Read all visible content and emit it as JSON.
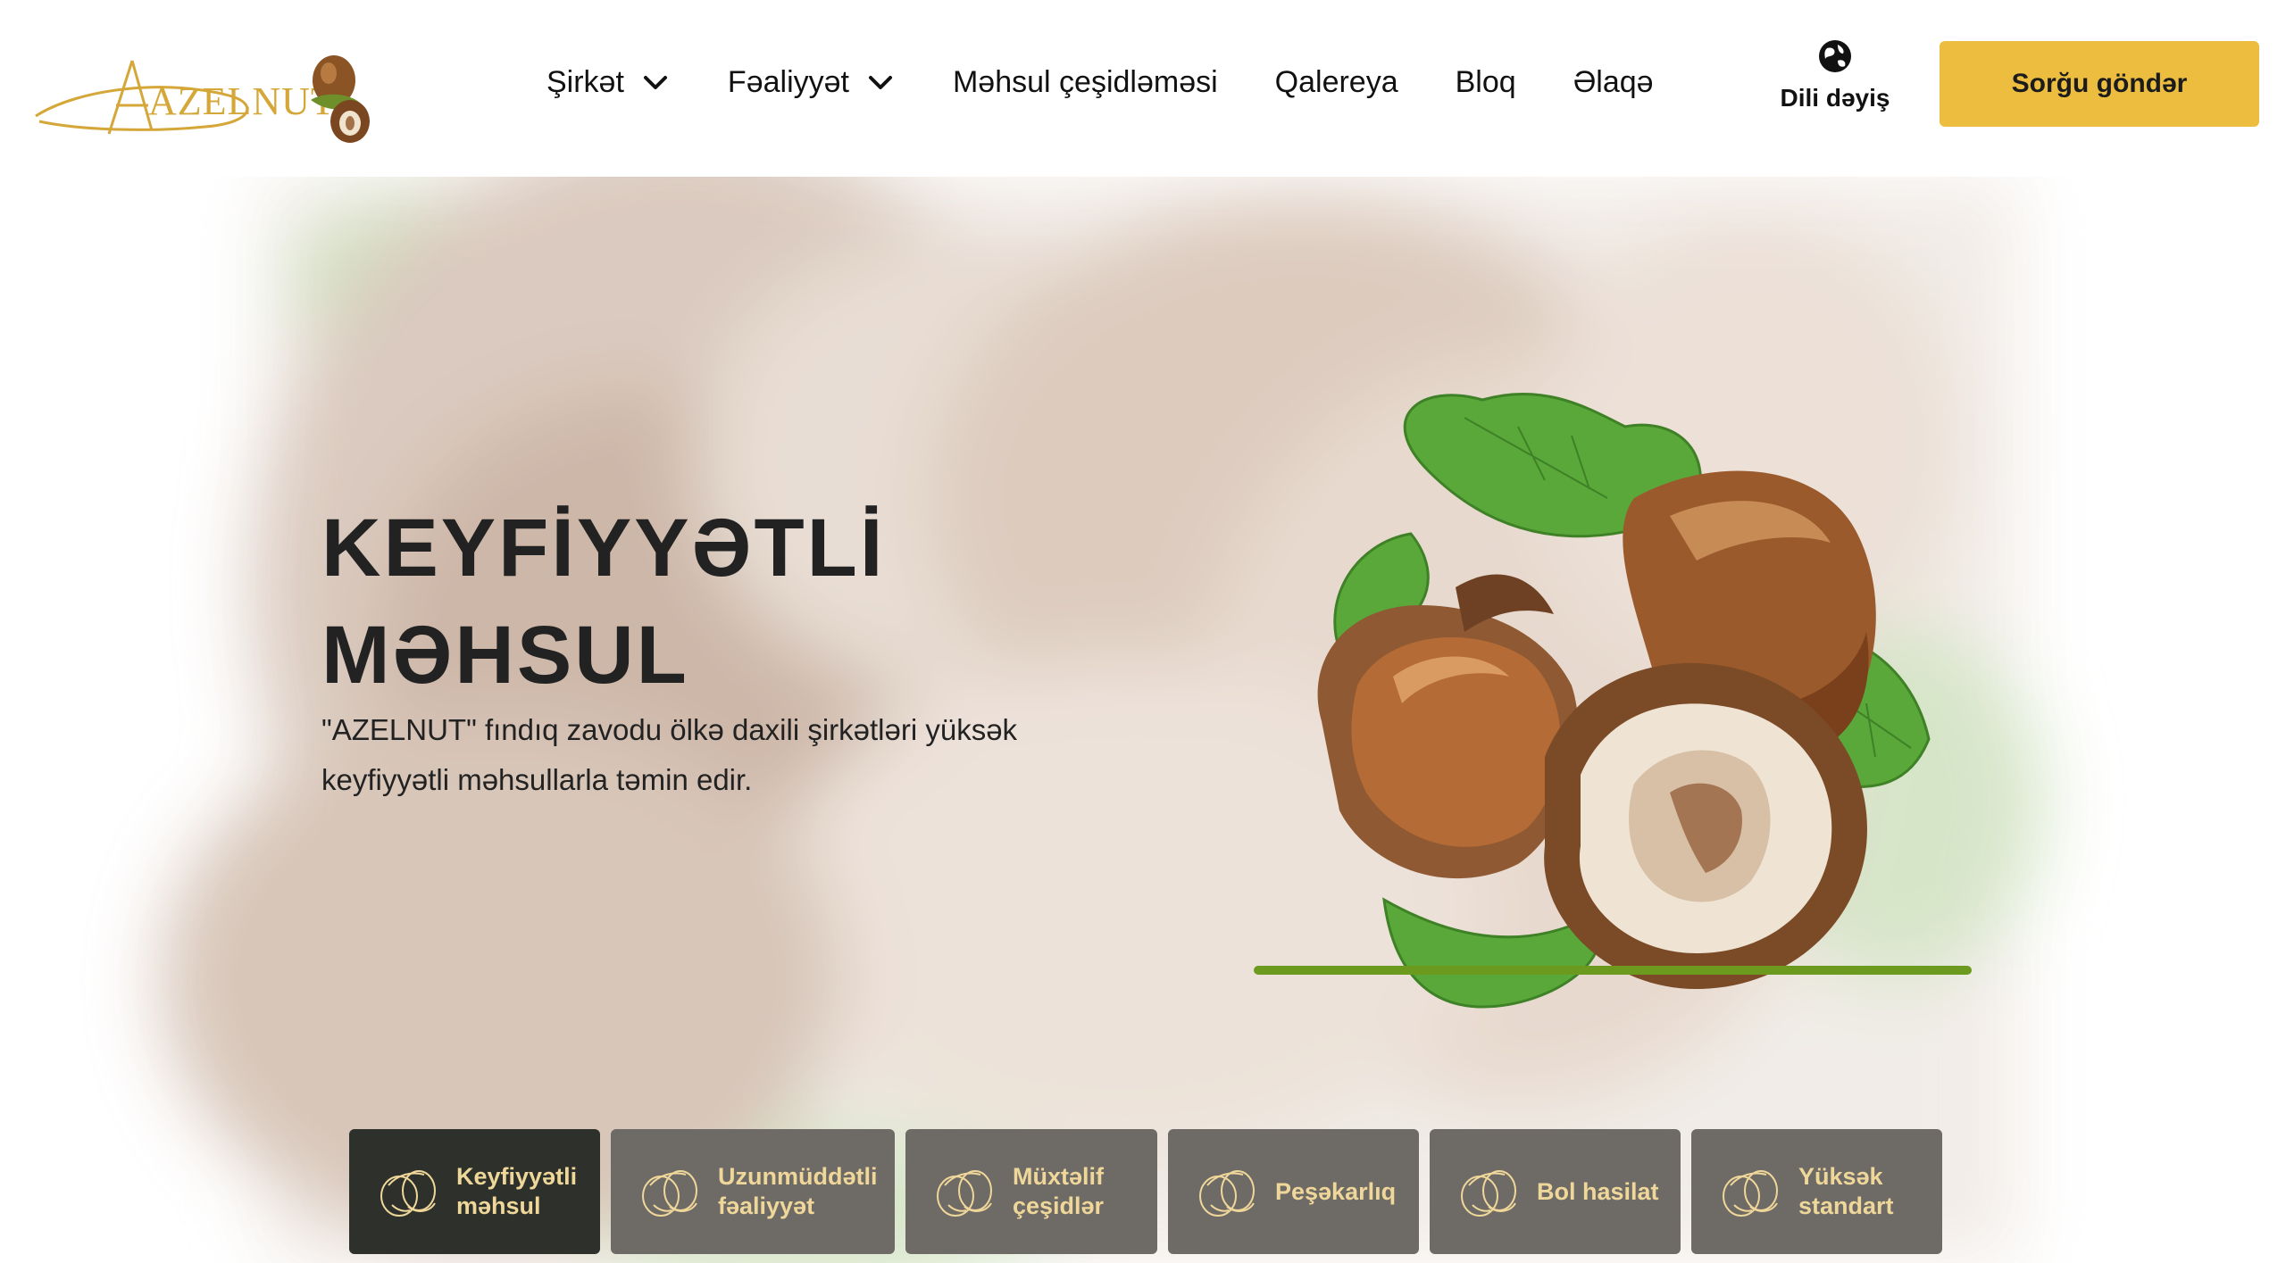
{
  "brand": {
    "logo_text": "AZELNUT"
  },
  "nav": {
    "items": [
      {
        "label": "Şirkət",
        "has_dropdown": true
      },
      {
        "label": "Fəaliyyət",
        "has_dropdown": true
      },
      {
        "label": "Məhsul çeşidləməsi",
        "has_dropdown": false
      },
      {
        "label": "Qalereya",
        "has_dropdown": false
      },
      {
        "label": "Bloq",
        "has_dropdown": false
      },
      {
        "label": "Əlaqə",
        "has_dropdown": false
      }
    ]
  },
  "lang": {
    "label": "Dili dəyiş",
    "icon": "globe-icon"
  },
  "cta": {
    "label": "Sorğu göndər"
  },
  "hero": {
    "title_line1": "KEYFİYYƏTLİ",
    "title_line2": "MƏHSUL",
    "subtitle": "\"AZELNUT\" fındıq zavodu ölkə daxili şirkətləri yüksək keyfiyyətli məhsullarla təmin edir."
  },
  "tabs": [
    {
      "label": "Keyfiyyətli\nməhsul",
      "active": true
    },
    {
      "label": "Uzunmüddətli\nfəaliyyət",
      "active": false
    },
    {
      "label": "Müxtəlif\nçeşidlər",
      "active": false
    },
    {
      "label": "Peşəkarlıq",
      "active": false
    },
    {
      "label": "Bol hasilat",
      "active": false
    },
    {
      "label": "Yüksək\nstandart",
      "active": false
    }
  ],
  "colors": {
    "accent": "#ecbd3f",
    "tab_active": "#2e302b",
    "tab_inactive": "#6e6a66",
    "tab_text": "#efd79a",
    "green_line": "#6b9a1e"
  }
}
